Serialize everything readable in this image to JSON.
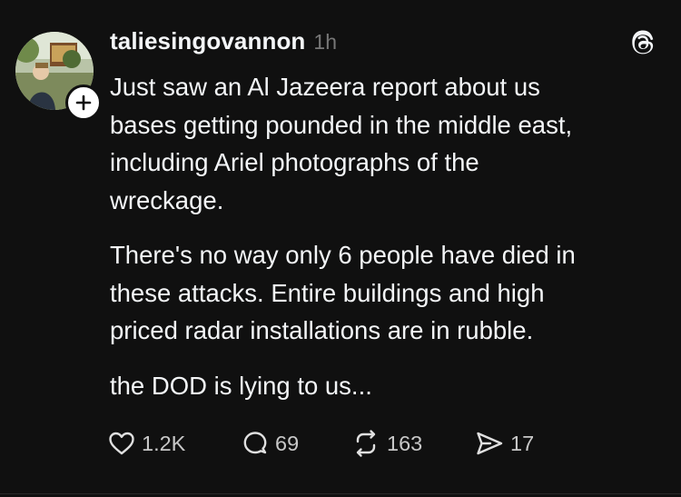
{
  "post": {
    "username": "taliesingovannon",
    "timestamp": "1h",
    "paragraphs": [
      "Just saw an Al Jazeera report about us\nbases getting pounded in the middle east,\nincluding Ariel photographs of the\nwreckage.",
      "There's no way only 6 people have died in\nthese attacks. Entire buildings and high\npriced radar installations are in rubble.",
      "the DOD is lying to us..."
    ],
    "actions": {
      "likes": "1.2K",
      "replies": "69",
      "reposts": "163",
      "shares": "17"
    }
  },
  "icons": {
    "follow": "plus-icon",
    "brand": "threads-logo-icon",
    "like": "heart-icon",
    "reply": "comment-bubble-icon",
    "repost": "repost-icon",
    "share": "send-icon"
  },
  "colors": {
    "background": "#101010",
    "text": "#f3f5f7",
    "muted": "#777777"
  }
}
